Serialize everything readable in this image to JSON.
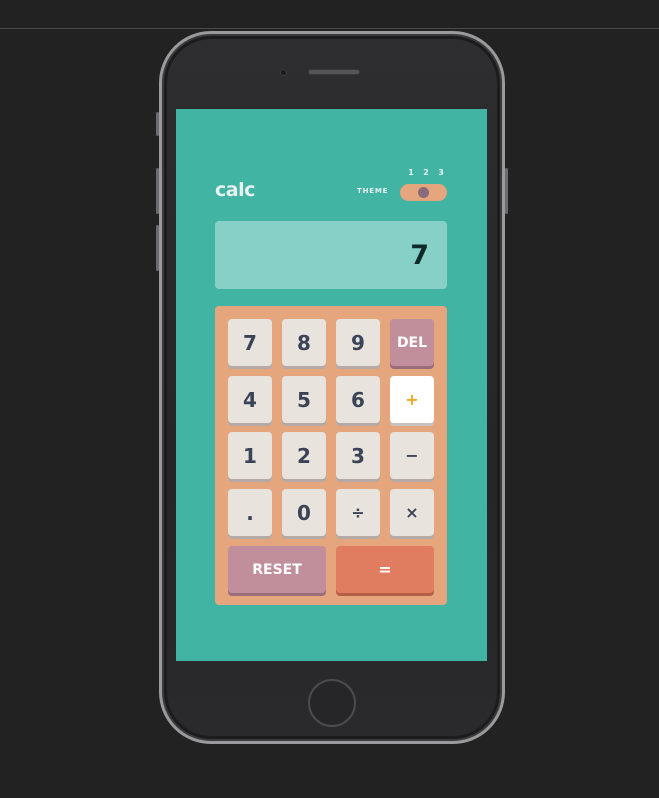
{
  "app": {
    "logo": "calc"
  },
  "theme": {
    "label": "THEME",
    "options": [
      "1",
      "2",
      "3"
    ],
    "selected": 2
  },
  "display": {
    "value": "7"
  },
  "keys": {
    "seven": "7",
    "eight": "8",
    "nine": "9",
    "del": "DEL",
    "four": "4",
    "five": "5",
    "six": "6",
    "plus": "+",
    "one": "1",
    "two": "2",
    "three": "3",
    "minus": "−",
    "dot": ".",
    "zero": "0",
    "divide": "÷",
    "multiply": "×",
    "reset": "RESET",
    "equals": "="
  },
  "colors": {
    "background": "#41b4a4",
    "display": "#86d0c8",
    "keypad": "#e5a67e",
    "key": "#e9e3de",
    "key_accent": "#c18e9c",
    "equals": "#e07d60",
    "plus_text": "#f4a52a"
  }
}
